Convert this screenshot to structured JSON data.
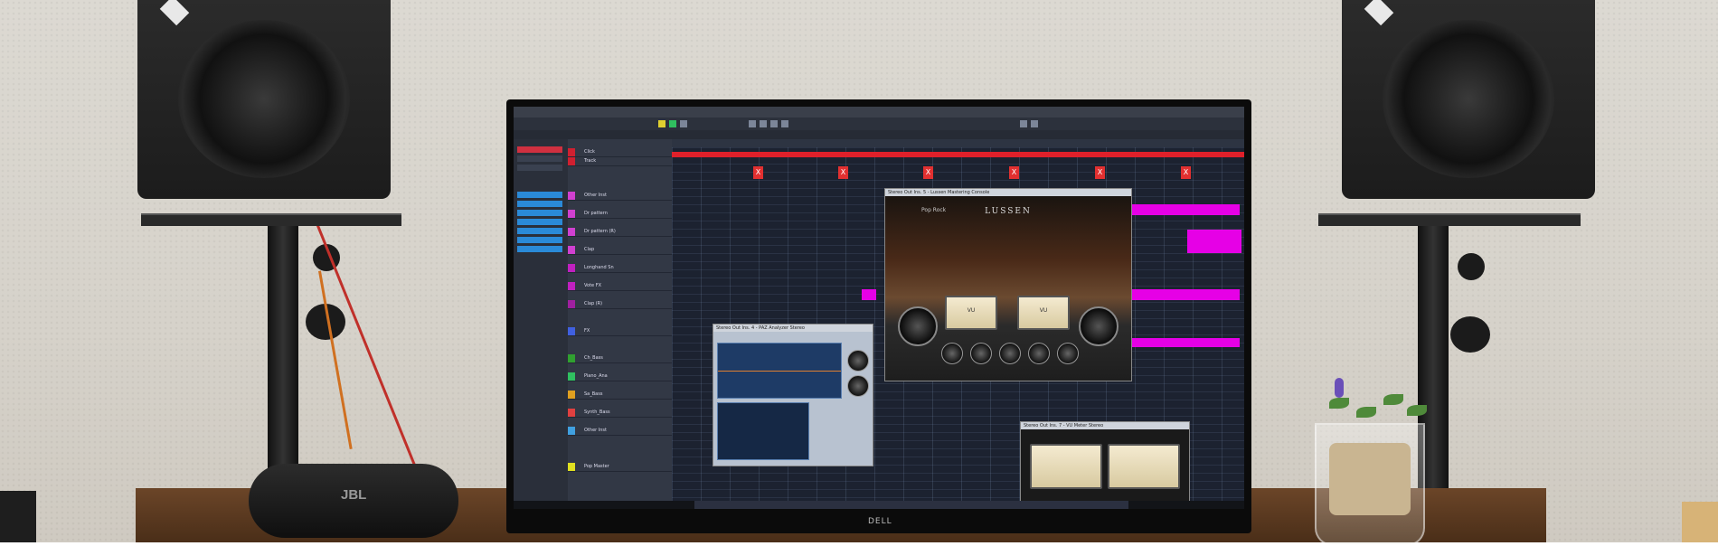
{
  "scene": "studio desk",
  "monitor": {
    "brand": "DELL",
    "screen": {
      "app": "DAW",
      "tracks": [
        {
          "name": "Click",
          "color": "#d02030"
        },
        {
          "name": "Track",
          "color": "#d02030"
        },
        {
          "name": "Other Inst",
          "color": "#d040d0"
        },
        {
          "name": "Dr pattern",
          "color": "#d040d0"
        },
        {
          "name": "Dr pattern (R)",
          "color": "#d040d0"
        },
        {
          "name": "Clap",
          "color": "#d040d0"
        },
        {
          "name": "Longhand Sn",
          "color": "#c020c0"
        },
        {
          "name": "Vote FX",
          "color": "#c020c0"
        },
        {
          "name": "Clap (R)",
          "color": "#a020a0"
        },
        {
          "name": "FX",
          "color": "#4060e0"
        },
        {
          "name": "Ch_Bass",
          "color": "#30a030"
        },
        {
          "name": "Piano_Ana",
          "color": "#30c060"
        },
        {
          "name": "Sa_Bass",
          "color": "#e0a020"
        },
        {
          "name": "Synth_Bass",
          "color": "#e04040"
        },
        {
          "name": "Other Inst",
          "color": "#40a0e0"
        },
        {
          "name": "Pop Master",
          "color": "#e0e020"
        }
      ],
      "markers": [
        "X",
        "X",
        "X",
        "X",
        "X",
        "X"
      ],
      "plugins": {
        "lussen": {
          "title": "Stereo Out Ins. 5 - Lussen Mastering Console",
          "brand": "LUSSEN",
          "preset": "Pop Rock"
        },
        "eq": {
          "title": "Stereo Out Ins. 4 - PAZ Analyzer Stereo"
        },
        "vu": {
          "title": "Stereo Out Ins. 7 - VU Meter Stereo"
        }
      }
    }
  },
  "jbl_logo": "JBL",
  "colors": {
    "red": "#e0202a",
    "magenta": "#e600e6",
    "bg": "#1c2230"
  }
}
